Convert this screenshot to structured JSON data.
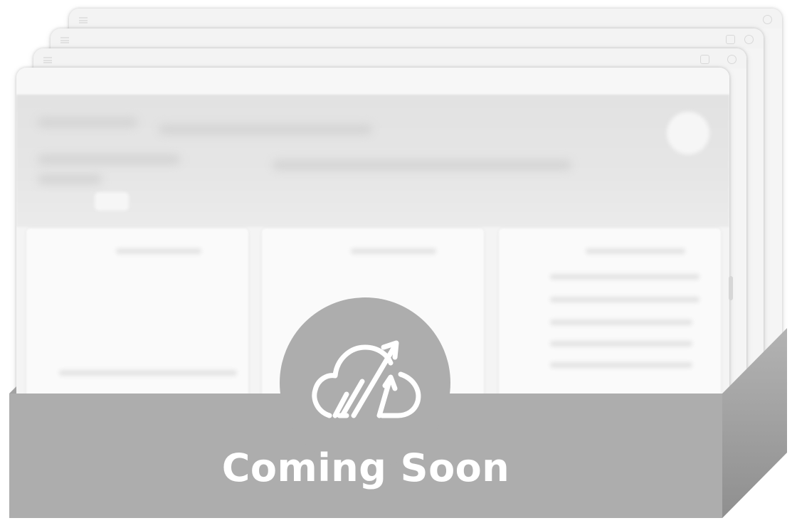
{
  "banner": {
    "title": "Coming Soon"
  },
  "logo": {
    "icon": "cloud-growth-arrows-icon"
  },
  "colors": {
    "box_front": "#adadad",
    "box_side_top": "#b3b3b3",
    "box_side_bottom": "#8f8f8f",
    "text": "#ffffff",
    "card_background": "#f5f5f5"
  }
}
